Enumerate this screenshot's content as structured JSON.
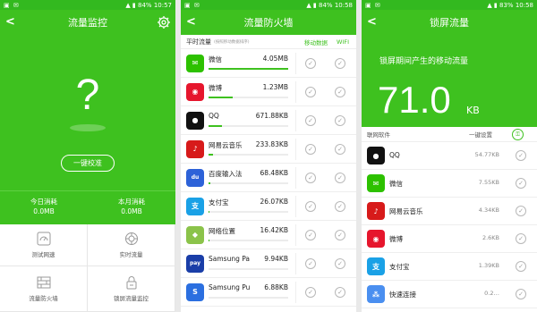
{
  "status": {
    "p1": {
      "battery": "84%",
      "time": "10:57"
    },
    "p2": {
      "battery": "84%",
      "time": "10:58"
    },
    "p3": {
      "battery": "83%",
      "time": "10:58"
    }
  },
  "colors": {
    "accent": "#3ec11f",
    "status_bar": "#33b91f"
  },
  "screen1": {
    "title": "流量监控",
    "placeholder_symbol": "?",
    "calibrate_label": "一键校准",
    "today": {
      "label": "今日消耗",
      "value": "0.0MB"
    },
    "month": {
      "label": "本月消耗",
      "value": "0.0MB"
    },
    "tiles": [
      {
        "label": "测试网速",
        "icon": "speedometer-icon"
      },
      {
        "label": "实时流量",
        "icon": "realtime-icon"
      },
      {
        "label": "流量防火墙",
        "icon": "firewall-icon"
      },
      {
        "label": "锁屏流量监控",
        "icon": "lock-monitor-icon"
      }
    ]
  },
  "screen2": {
    "title": "流量防火墙",
    "sub_label": "平时流量",
    "sub_note": "(按照移动数据排序)",
    "tab_mobile": "移动数据",
    "tab_wifi": "WIFI",
    "apps": [
      {
        "name": "微信",
        "value": "4.05MB",
        "fill": 1.0,
        "color": "#2dc100",
        "glyph": "✉"
      },
      {
        "name": "微博",
        "value": "1.23MB",
        "fill": 0.3,
        "color": "#e6162d",
        "glyph": "◉"
      },
      {
        "name": "QQ",
        "value": "671.88KB",
        "fill": 0.17,
        "color": "#111111",
        "glyph": "●"
      },
      {
        "name": "网易云音乐",
        "value": "233.83KB",
        "fill": 0.06,
        "color": "#d71a1a",
        "glyph": "♪"
      },
      {
        "name": "百度输入法",
        "value": "68.48KB",
        "fill": 0.02,
        "color": "#2d62d8",
        "glyph": "du"
      },
      {
        "name": "支付宝",
        "value": "26.07KB",
        "fill": 0.01,
        "color": "#1aa1e6",
        "glyph": "支"
      },
      {
        "name": "网络位置",
        "value": "16.42KB",
        "fill": 0.01,
        "color": "#8bc34a",
        "glyph": "◆"
      },
      {
        "name": "Samsung Pa",
        "value": "9.94KB",
        "fill": 0.0,
        "color": "#1a3ea8",
        "glyph": "pay"
      },
      {
        "name": "Samsung Pu",
        "value": "6.88KB",
        "fill": 0.0,
        "color": "#2b6fe0",
        "glyph": "S"
      }
    ]
  },
  "screen3": {
    "title": "锁屏流量",
    "caption": "锁屏期间产生的移动流量",
    "big_value": "71.0",
    "big_unit": "KB",
    "col_apps": "联网软件",
    "col_set": "一键设置",
    "apps": [
      {
        "name": "QQ",
        "value": "54.77KB",
        "color": "#111111",
        "glyph": "●"
      },
      {
        "name": "微信",
        "value": "7.55KB",
        "color": "#2dc100",
        "glyph": "✉"
      },
      {
        "name": "网易云音乐",
        "value": "4.34KB",
        "color": "#d71a1a",
        "glyph": "♪"
      },
      {
        "name": "微博",
        "value": "2.6KB",
        "color": "#e6162d",
        "glyph": "◉"
      },
      {
        "name": "支付宝",
        "value": "1.39KB",
        "color": "#1aa1e6",
        "glyph": "支"
      },
      {
        "name": "快速连接",
        "value": "0.2…",
        "color": "#4a8ff0",
        "glyph": "⁂"
      }
    ]
  }
}
